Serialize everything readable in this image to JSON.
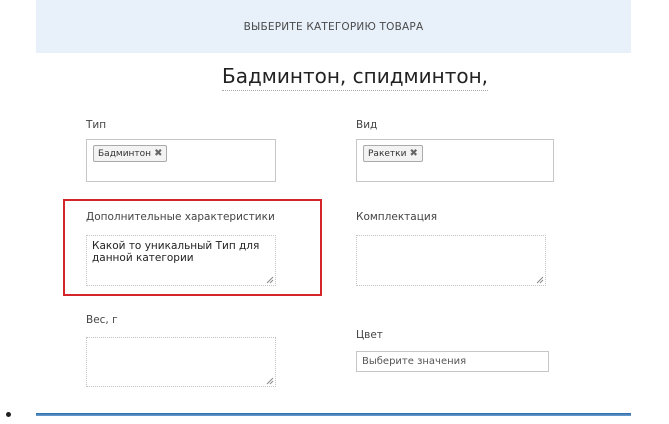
{
  "header": {
    "title": "ВЫБЕРИТЕ КАТЕГОРИЮ ТОВАРА"
  },
  "category_title": "Бадминтон, спидминтон,",
  "fields": {
    "type": {
      "label": "Тип",
      "tag": "Бадминтон"
    },
    "kind": {
      "label": "Вид",
      "tag": "Ракетки"
    },
    "extra": {
      "label": "Дополнительные характеристики",
      "value": "Какой то уникальный Тип для данной категории"
    },
    "kit": {
      "label": "Комплектация",
      "value": ""
    },
    "weight": {
      "label": "Вес, г",
      "value": ""
    },
    "color": {
      "label": "Цвет",
      "placeholder": "Выберите значения"
    }
  },
  "colors": {
    "highlight": "#d3252a",
    "header_bg": "#e8f0fa"
  }
}
